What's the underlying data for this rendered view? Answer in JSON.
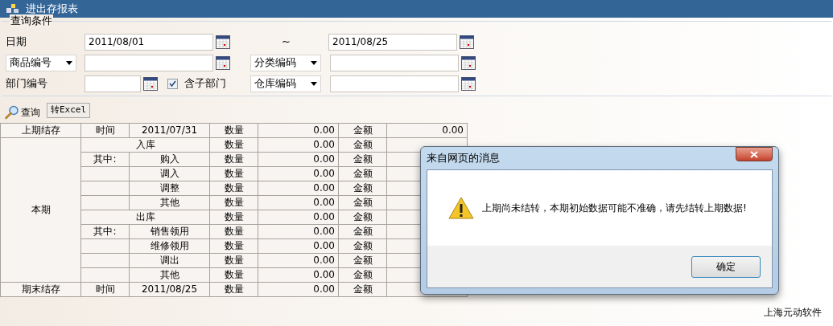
{
  "window": {
    "title": "进出存报表"
  },
  "filters": {
    "legend": "查询条件",
    "date": {
      "label": "日期",
      "from": "2011/08/01",
      "separator": "~",
      "to": "2011/08/25"
    },
    "row2": {
      "left_select": "商品编号",
      "right_select": "分类编码"
    },
    "row3": {
      "label": "部门编号",
      "checkbox": {
        "label": "含子部门",
        "checked": true
      },
      "right_select": "仓库编码"
    }
  },
  "toolbar": {
    "query": "查询",
    "export": "转Excel"
  },
  "table": {
    "opening": {
      "label": "上期结存",
      "time_label": "时间",
      "date": "2011/07/31",
      "qty_label": "数量",
      "qty": "0.00",
      "amount_label": "金额",
      "amount": "0.00"
    },
    "current": {
      "label": "本期",
      "rows": [
        {
          "kind": "group",
          "name": "入库",
          "qty_label": "数量",
          "qty": "0.00",
          "amount_label": "金额"
        },
        {
          "kind": "item",
          "prefix": "其中:",
          "name": "购入",
          "qty_label": "数量",
          "qty": "0.00",
          "amount_label": "金额"
        },
        {
          "kind": "item",
          "name": "调入",
          "qty_label": "数量",
          "qty": "0.00",
          "amount_label": "金额"
        },
        {
          "kind": "item",
          "name": "调整",
          "qty_label": "数量",
          "qty": "0.00",
          "amount_label": "金额"
        },
        {
          "kind": "item",
          "name": "其他",
          "qty_label": "数量",
          "qty": "0.00",
          "amount_label": "金额"
        },
        {
          "kind": "group",
          "name": "出库",
          "qty_label": "数量",
          "qty": "0.00",
          "amount_label": "金额"
        },
        {
          "kind": "item",
          "prefix": "其中:",
          "name": "销售领用",
          "qty_label": "数量",
          "qty": "0.00",
          "amount_label": "金额"
        },
        {
          "kind": "item",
          "name": "维修领用",
          "qty_label": "数量",
          "qty": "0.00",
          "amount_label": "金额"
        },
        {
          "kind": "item",
          "name": "调出",
          "qty_label": "数量",
          "qty": "0.00",
          "amount_label": "金额"
        },
        {
          "kind": "item",
          "name": "其他",
          "qty_label": "数量",
          "qty": "0.00",
          "amount_label": "金额"
        }
      ]
    },
    "closing": {
      "label": "期末结存",
      "time_label": "时间",
      "date": "2011/08/25",
      "qty_label": "数量",
      "qty": "0.00",
      "amount_label": "金额"
    }
  },
  "footer": "上海元动软件",
  "dialog": {
    "title": "来自网页的消息",
    "message": "上期尚未结转，本期初始数据可能不准确，请先结转上期数据!",
    "ok": "确定"
  }
}
